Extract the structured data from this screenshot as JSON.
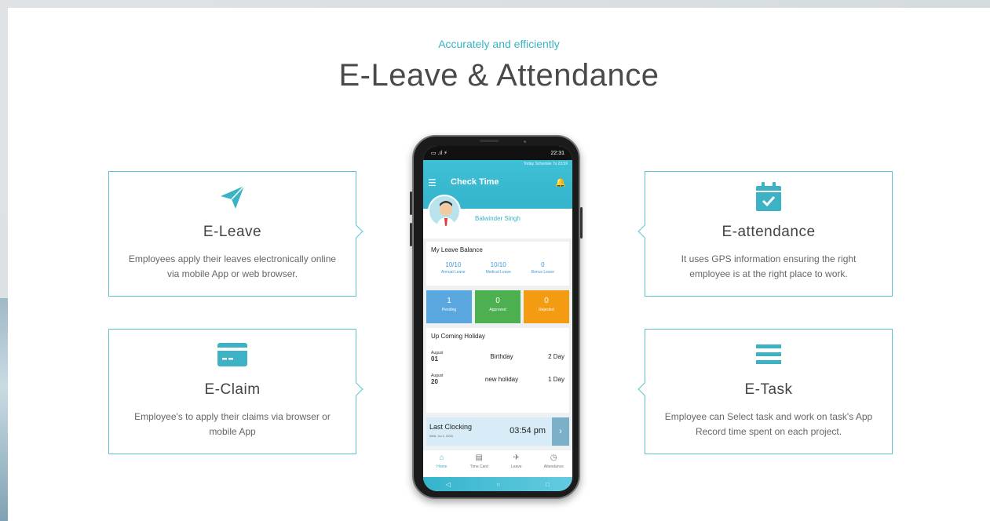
{
  "header": {
    "subtitle": "Accurately and efficiently",
    "title": "E-Leave & Attendance"
  },
  "colors": {
    "accent": "#3bb3c4",
    "border": "#5cc3d2",
    "pending": "#5aa7e0",
    "approved": "#4caf50",
    "rejected": "#f39c12"
  },
  "features": [
    {
      "icon": "paper-plane-icon",
      "title": "E-Leave",
      "desc": "Employees apply their leaves electronically online via mobile App or web browser."
    },
    {
      "icon": "credit-card-icon",
      "title": "E-Claim",
      "desc": "Employee's to apply their claims via browser or mobile App"
    },
    {
      "icon": "calendar-check-icon",
      "title": "E-attendance",
      "desc": "It uses GPS information ensuring the right employee is at the right place to work."
    },
    {
      "icon": "list-icon",
      "title": "E-Task",
      "desc": "Employee can Select task and work on task's App Record time spent on each project."
    }
  ],
  "phone": {
    "status_left": "▭ .ıl ⚡",
    "status_time": "22:31",
    "schedule": "Today Schedule  7s 23:59",
    "app_title": "Check Time",
    "user_name": "Balwinder Singh",
    "leave_balance": {
      "title": "My Leave Balance",
      "items": [
        {
          "value": "10/10",
          "label": "Annual Leave"
        },
        {
          "value": "10/10",
          "label": "Medical Leave"
        },
        {
          "value": "0",
          "label": "Bonus Leave"
        }
      ]
    },
    "tiles": [
      {
        "count": "1",
        "label": "Pending"
      },
      {
        "count": "0",
        "label": "Approved"
      },
      {
        "count": "0",
        "label": "Rejected"
      }
    ],
    "holidays": {
      "title": "Up Coming Holiday",
      "items": [
        {
          "month": "August",
          "day": "01",
          "name": "Birthday",
          "duration": "2 Day"
        },
        {
          "month": "August",
          "day": "20",
          "name": "new holiday",
          "duration": "1 Day"
        }
      ]
    },
    "clocking": {
      "label": "Last Clocking",
      "date": "Wed, Jul 1, 2020",
      "time": "03:54 pm"
    },
    "nav": [
      {
        "label": "Home",
        "icon": "home-icon"
      },
      {
        "label": "Time Card",
        "icon": "time-card-icon"
      },
      {
        "label": "Leave",
        "icon": "leave-icon"
      },
      {
        "label": "Attendance",
        "icon": "clock-icon"
      }
    ]
  }
}
